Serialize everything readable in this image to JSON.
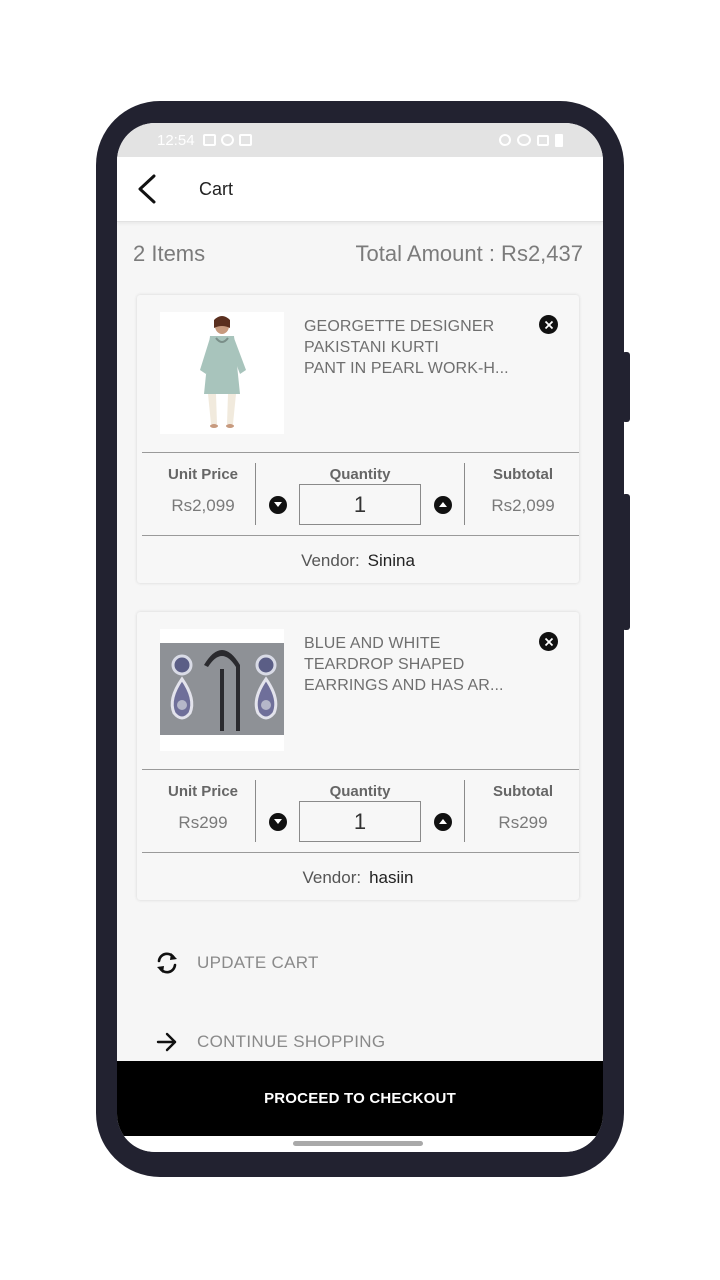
{
  "status_bar": {
    "time": "12:54"
  },
  "app_bar": {
    "title": "Cart"
  },
  "summary": {
    "item_count": "2 Items",
    "total": "Total Amount : Rs2,437"
  },
  "labels": {
    "unit_price": "Unit Price",
    "quantity": "Quantity",
    "subtotal": "Subtotal",
    "vendor": "Vendor:"
  },
  "items": [
    {
      "name": "GEORGETTE DESIGNER\nPAKISTANI KURTI\nPANT IN PEARL WORK-H...",
      "unit_price": "Rs2,099",
      "quantity": "1",
      "subtotal": "Rs2,099",
      "vendor": "Sinina"
    },
    {
      "name": "BLUE AND WHITE\nTEARDROP SHAPED\nEARRINGS AND HAS AR...",
      "unit_price": "Rs299",
      "quantity": "1",
      "subtotal": "Rs299",
      "vendor": "hasiin"
    }
  ],
  "actions": {
    "update_cart": "UPDATE CART",
    "continue_shopping": "CONTINUE SHOPPING",
    "checkout": "PROCEED TO CHECKOUT"
  },
  "icons": {
    "back": "arrow-back-icon",
    "remove": "close-circle-icon",
    "decrease": "chevron-down-circle-icon",
    "increase": "chevron-up-circle-icon",
    "update": "refresh-icon",
    "continue": "arrow-right-icon"
  },
  "colors": {
    "checkout_bg": "#000000",
    "muted_text": "#7b7b7b"
  }
}
